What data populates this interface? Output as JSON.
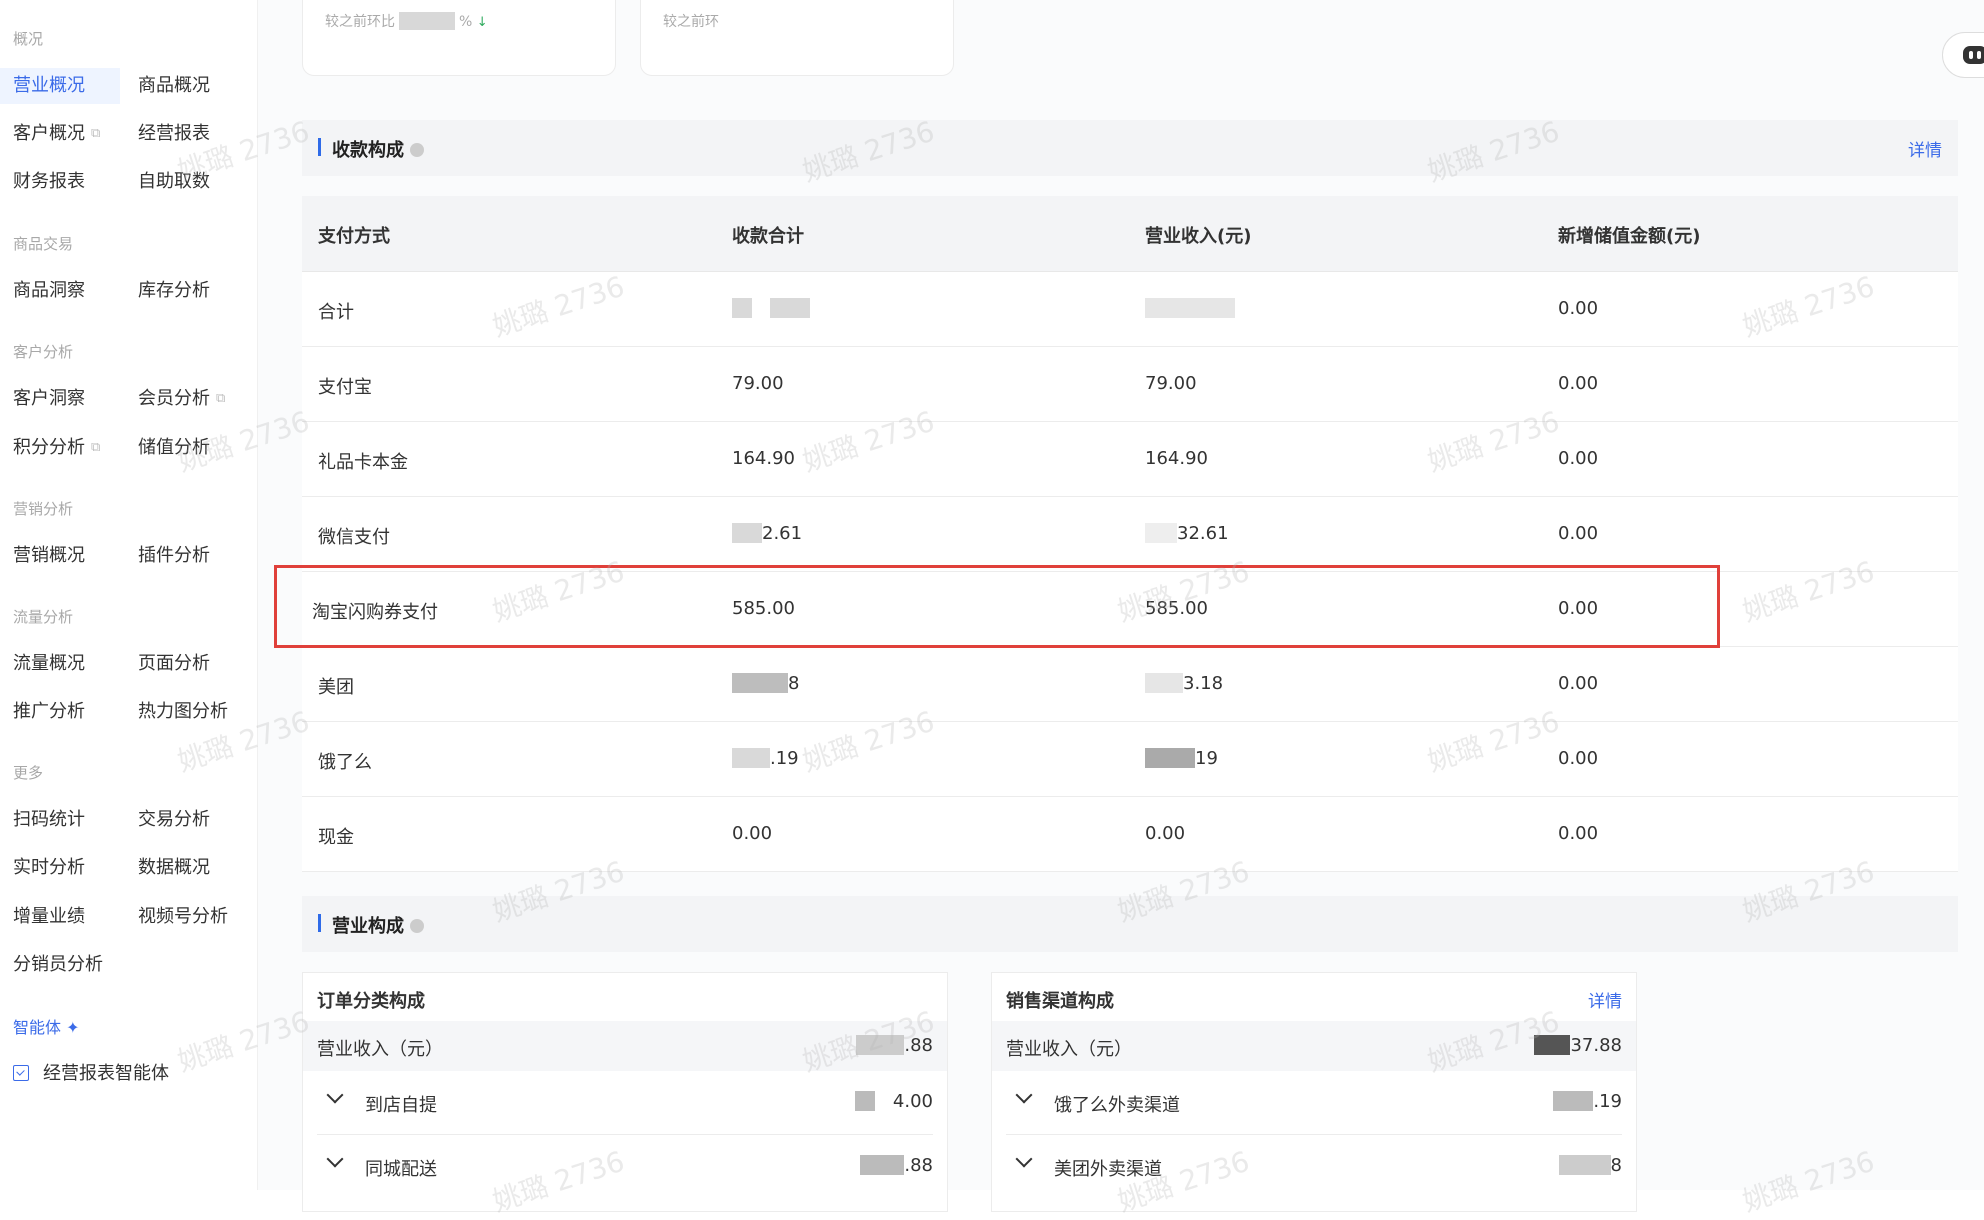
{
  "sidebar": {
    "groups": [
      {
        "title": "概况",
        "items": [
          [
            "营业概况",
            "商品概况"
          ],
          [
            "客户概况",
            "经营报表"
          ],
          [
            "财务报表",
            "自助取数"
          ]
        ]
      },
      {
        "title": "商品交易",
        "items": [
          [
            "商品洞察",
            "库存分析"
          ]
        ]
      },
      {
        "title": "客户分析",
        "items": [
          [
            "客户洞察",
            "会员分析"
          ],
          [
            "积分分析",
            "储值分析"
          ]
        ]
      },
      {
        "title": "营销分析",
        "items": [
          [
            "营销概况",
            "插件分析"
          ]
        ]
      },
      {
        "title": "流量分析",
        "items": [
          [
            "流量概况",
            "页面分析"
          ],
          [
            "推广分析",
            "热力图分析"
          ]
        ]
      },
      {
        "title": "更多",
        "items": [
          [
            "扫码统计",
            "交易分析"
          ],
          [
            "实时分析",
            "数据概况"
          ],
          [
            "增量业绩",
            "视频号分析"
          ],
          [
            "分销员分析",
            ""
          ]
        ]
      }
    ],
    "ai_title": "智能体",
    "ai_item": "经营报表智能体"
  },
  "kpi": {
    "card1_compare": "较之前环比",
    "card1_unit": "%",
    "card2_compare": "较之前环"
  },
  "collection": {
    "title": "收款构成",
    "detail": "详情",
    "headers": [
      "支付方式",
      "收款合计",
      "营业收入(元)",
      "新增储值金额(元)"
    ],
    "rows": [
      {
        "method": "合计",
        "total": "",
        "revenue": "",
        "stored": "0.00"
      },
      {
        "method": "支付宝",
        "total": "79.00",
        "revenue": "79.00",
        "stored": "0.00"
      },
      {
        "method": "礼品卡本金",
        "total": "164.90",
        "revenue": "164.90",
        "stored": "0.00"
      },
      {
        "method": "微信支付",
        "total": "2.61",
        "revenue": "32.61",
        "stored": "0.00"
      },
      {
        "method": "淘宝闪购券支付",
        "total": "585.00",
        "revenue": "585.00",
        "stored": "0.00"
      },
      {
        "method": "美团",
        "total": "8",
        "revenue": "3.18",
        "stored": "0.00"
      },
      {
        "method": "饿了么",
        "total": ".19",
        "revenue": "19",
        "stored": "0.00"
      },
      {
        "method": "现金",
        "total": "0.00",
        "revenue": "0.00",
        "stored": "0.00"
      }
    ]
  },
  "business": {
    "title": "营业构成",
    "order_panel": {
      "title": "订单分类构成",
      "sum_label": "营业收入（元）",
      "sum_value": ".88",
      "rows": [
        {
          "label": "到店自提",
          "value": "4.00"
        },
        {
          "label": "同城配送",
          "value": ".88"
        }
      ]
    },
    "channel_panel": {
      "title": "销售渠道构成",
      "detail": "详情",
      "sum_label": "营业收入（元）",
      "sum_value": "37.88",
      "rows": [
        {
          "label": "饿了么外卖渠道",
          "value": ".19"
        },
        {
          "label": "美团外卖渠道",
          "value": "8"
        }
      ]
    }
  },
  "watermark": "姚璐 2736",
  "colors": {
    "accent": "#3b6be8",
    "highlight": "#e0403a"
  }
}
